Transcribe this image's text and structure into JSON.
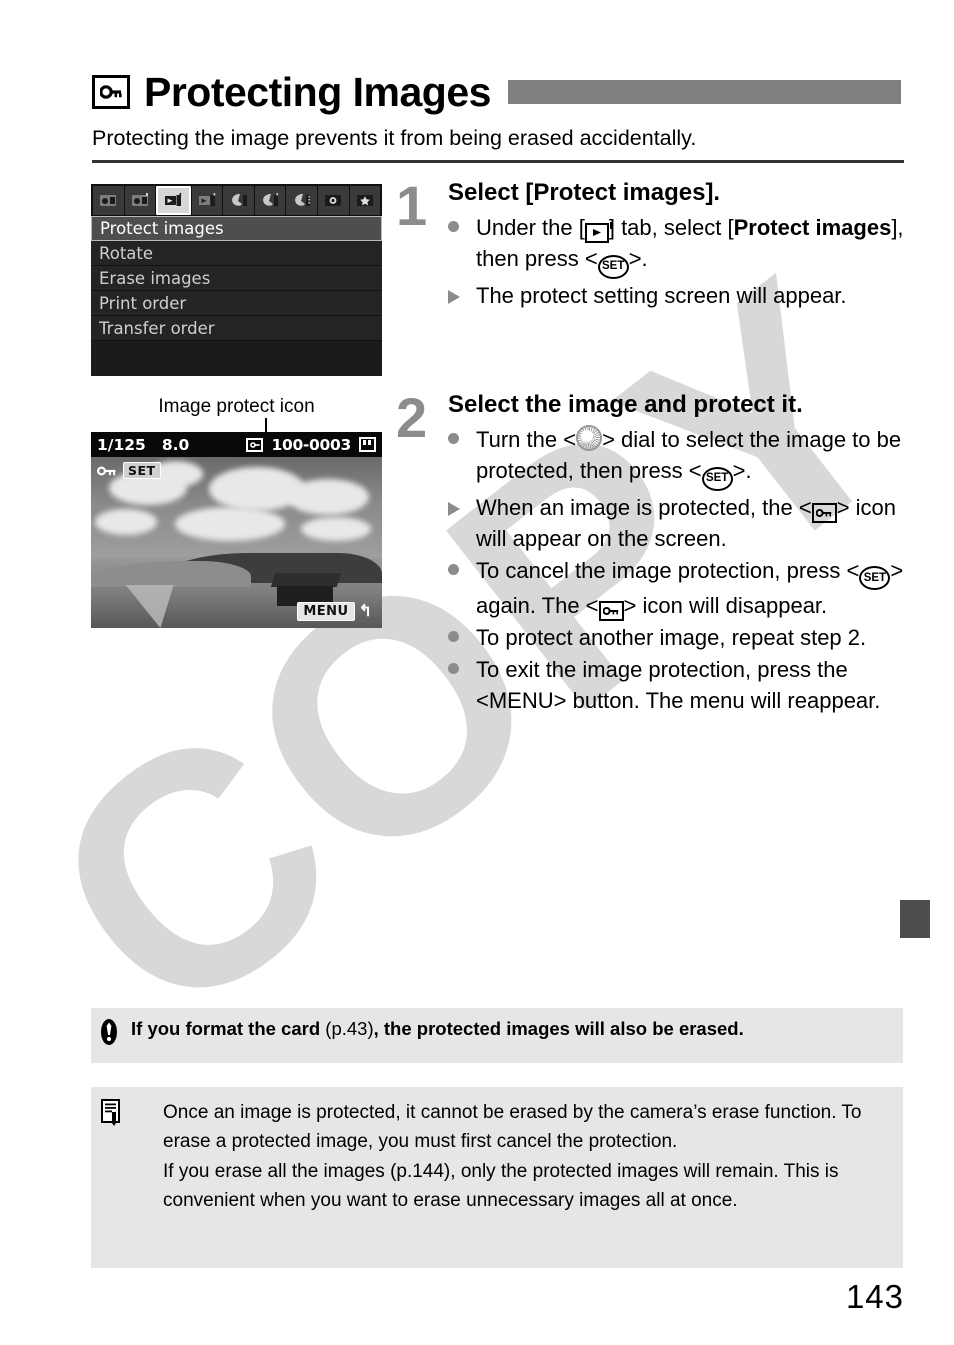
{
  "watermark": {
    "text": "COPY"
  },
  "header": {
    "icon": "key-icon",
    "title": "Protecting Images",
    "intro": "Protecting the image prevents it from being erased accidentally."
  },
  "figures": {
    "menu_screen": {
      "tabs": [
        {
          "name": "shooting-tab-1",
          "selected": false
        },
        {
          "name": "shooting-tab-2",
          "selected": false
        },
        {
          "name": "playback-tab-1",
          "selected": true
        },
        {
          "name": "playback-tab-2",
          "selected": false
        },
        {
          "name": "setup-tab-1",
          "selected": false
        },
        {
          "name": "setup-tab-2",
          "selected": false
        },
        {
          "name": "setup-tab-3",
          "selected": false
        },
        {
          "name": "custom-functions-tab",
          "selected": false
        },
        {
          "name": "my-menu-tab",
          "selected": false
        }
      ],
      "items": [
        {
          "label": "Protect images",
          "selected": true
        },
        {
          "label": "Rotate",
          "selected": false
        },
        {
          "label": "Erase images",
          "selected": false
        },
        {
          "label": "Print order",
          "selected": false
        },
        {
          "label": "Transfer order",
          "selected": false
        }
      ]
    },
    "photo_screen": {
      "caption": "Image protect icon",
      "shutter_speed": "1/125",
      "aperture": "8.0",
      "protect_icon": "protect-icon",
      "frame_number": "100-0003",
      "card_icon": "sd-card-icon",
      "overlay_key_icon": "key-icon",
      "overlay_set_label": "SET",
      "menu_label": "MENU",
      "return_glyph": "↰"
    }
  },
  "steps": [
    {
      "number": "1",
      "title": "Select [Protect images].",
      "bullets": [
        {
          "mark": "dot",
          "parts": [
            {
              "t": "text",
              "v": "Under the ["
            },
            {
              "t": "icon",
              "v": "playback-tab-icon"
            },
            {
              "t": "text",
              "v": "] tab, select ["
            },
            {
              "t": "bold",
              "v": "Protect images"
            },
            {
              "t": "text",
              "v": "], then press <"
            },
            {
              "t": "icon",
              "v": "set-icon"
            },
            {
              "t": "text",
              "v": ">."
            }
          ]
        },
        {
          "mark": "triangle",
          "parts": [
            {
              "t": "text",
              "v": "The protect setting screen will appear."
            }
          ]
        }
      ]
    },
    {
      "number": "2",
      "title": "Select the image and protect it.",
      "bullets": [
        {
          "mark": "dot",
          "parts": [
            {
              "t": "text",
              "v": "Turn the <"
            },
            {
              "t": "icon",
              "v": "dial-icon"
            },
            {
              "t": "text",
              "v": "> dial to select the image to be protected, then press <"
            },
            {
              "t": "icon",
              "v": "set-icon"
            },
            {
              "t": "text",
              "v": ">."
            }
          ]
        },
        {
          "mark": "triangle",
          "parts": [
            {
              "t": "text",
              "v": "When an image is protected, the <"
            },
            {
              "t": "icon",
              "v": "key-icon"
            },
            {
              "t": "text",
              "v": "> icon will appear on the screen."
            }
          ]
        },
        {
          "mark": "dot",
          "parts": [
            {
              "t": "text",
              "v": "To cancel the image protection, press <"
            },
            {
              "t": "icon",
              "v": "set-icon"
            },
            {
              "t": "text",
              "v": "> again. The <"
            },
            {
              "t": "icon",
              "v": "key-icon"
            },
            {
              "t": "text",
              "v": "> icon will disappear."
            }
          ]
        },
        {
          "mark": "dot",
          "parts": [
            {
              "t": "text",
              "v": "To protect another image, repeat step 2."
            }
          ]
        },
        {
          "mark": "dot",
          "parts": [
            {
              "t": "text",
              "v": "To exit the image protection, press the <"
            },
            {
              "t": "menuword",
              "v": "MENU"
            },
            {
              "t": "text",
              "v": "> button. The menu will reappear."
            }
          ]
        }
      ]
    }
  ],
  "warning": {
    "icon": "exclamation-icon",
    "bold_before": "If you format the card ",
    "thin_ref": "(p.43)",
    "bold_after": ", the protected images will also be erased."
  },
  "note": {
    "icon": "notepad-icon",
    "items": [
      "Once an image is protected, it cannot be erased by the camera’s erase function. To erase a protected image, you must first cancel the protection.",
      "If you erase all the images (p.144), only the protected images will remain. This is convenient when you want to erase unnecessary images all at once."
    ]
  },
  "footer": {
    "page_number": "143"
  },
  "colors": {
    "title_bar": "#808080",
    "step_number": "#8c8c8c",
    "notice_bg": "#e6e6e6",
    "tab_marker": "#4d4d4d",
    "watermark": "#d8d8d8"
  }
}
